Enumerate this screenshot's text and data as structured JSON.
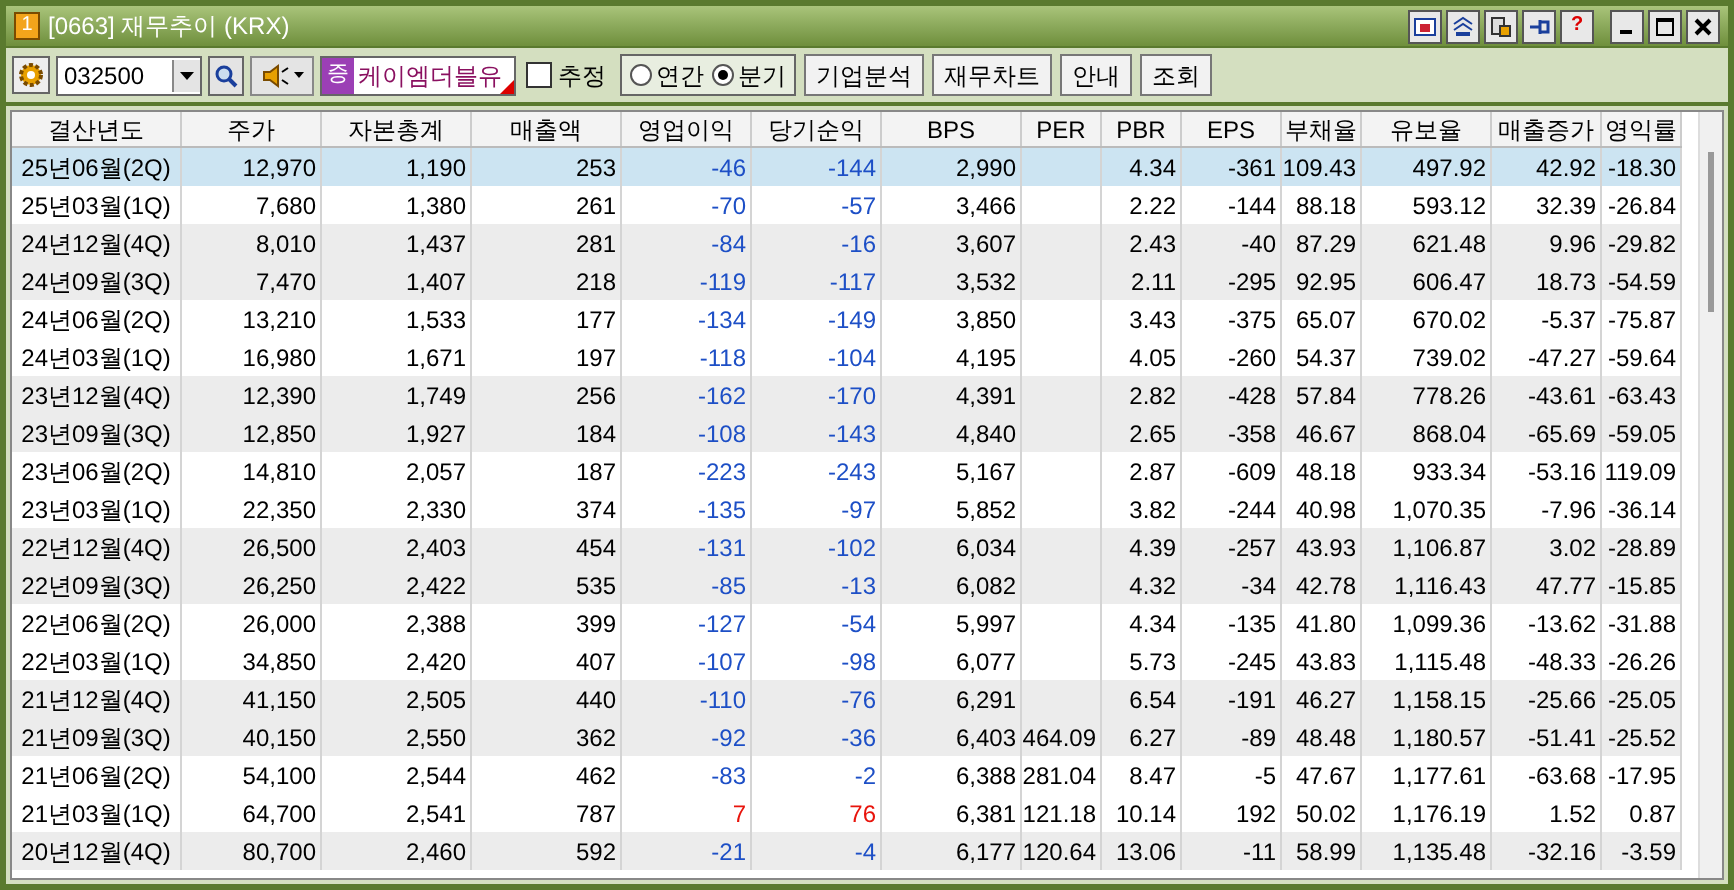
{
  "window": {
    "badge": "1",
    "title": "[0663] 재무추이 (KRX)",
    "help_glyph": "?"
  },
  "toolbar": {
    "code": "032500",
    "market_badge": "증",
    "company": "케이엠더블유",
    "estimate": {
      "label": "추정",
      "checked": false
    },
    "period": [
      {
        "label": "연간",
        "selected": false
      },
      {
        "label": "분기",
        "selected": true
      }
    ],
    "buttons": [
      "기업분석",
      "재무차트",
      "안내",
      "조회"
    ]
  },
  "table": {
    "columns": [
      "결산년도",
      "주가",
      "자본총계",
      "매출액",
      "영업이익",
      "당기순익",
      "BPS",
      "PER",
      "PBR",
      "EPS",
      "부채율",
      "유보율",
      "매출증가",
      "영익률"
    ],
    "rows": [
      {
        "selected": true,
        "loss": true,
        "cells": [
          "25년06월(2Q)",
          "12,970",
          "1,190",
          "253",
          "-46",
          "-144",
          "2,990",
          "",
          "4.34",
          "-361",
          "109.43",
          "497.92",
          "42.92",
          "-18.30"
        ]
      },
      {
        "selected": false,
        "shaded": false,
        "loss": true,
        "cells": [
          "25년03월(1Q)",
          "7,680",
          "1,380",
          "261",
          "-70",
          "-57",
          "3,466",
          "",
          "2.22",
          "-144",
          "88.18",
          "593.12",
          "32.39",
          "-26.84"
        ]
      },
      {
        "selected": false,
        "shaded": true,
        "loss": true,
        "cells": [
          "24년12월(4Q)",
          "8,010",
          "1,437",
          "281",
          "-84",
          "-16",
          "3,607",
          "",
          "2.43",
          "-40",
          "87.29",
          "621.48",
          "9.96",
          "-29.82"
        ]
      },
      {
        "selected": false,
        "shaded": true,
        "loss": true,
        "cells": [
          "24년09월(3Q)",
          "7,470",
          "1,407",
          "218",
          "-119",
          "-117",
          "3,532",
          "",
          "2.11",
          "-295",
          "92.95",
          "606.47",
          "18.73",
          "-54.59"
        ]
      },
      {
        "selected": false,
        "shaded": false,
        "loss": true,
        "cells": [
          "24년06월(2Q)",
          "13,210",
          "1,533",
          "177",
          "-134",
          "-149",
          "3,850",
          "",
          "3.43",
          "-375",
          "65.07",
          "670.02",
          "-5.37",
          "-75.87"
        ]
      },
      {
        "selected": false,
        "shaded": false,
        "loss": true,
        "cells": [
          "24년03월(1Q)",
          "16,980",
          "1,671",
          "197",
          "-118",
          "-104",
          "4,195",
          "",
          "4.05",
          "-260",
          "54.37",
          "739.02",
          "-47.27",
          "-59.64"
        ]
      },
      {
        "selected": false,
        "shaded": true,
        "loss": true,
        "cells": [
          "23년12월(4Q)",
          "12,390",
          "1,749",
          "256",
          "-162",
          "-170",
          "4,391",
          "",
          "2.82",
          "-428",
          "57.84",
          "778.26",
          "-43.61",
          "-63.43"
        ]
      },
      {
        "selected": false,
        "shaded": true,
        "loss": true,
        "cells": [
          "23년09월(3Q)",
          "12,850",
          "1,927",
          "184",
          "-108",
          "-143",
          "4,840",
          "",
          "2.65",
          "-358",
          "46.67",
          "868.04",
          "-65.69",
          "-59.05"
        ]
      },
      {
        "selected": false,
        "shaded": false,
        "loss": true,
        "cells": [
          "23년06월(2Q)",
          "14,810",
          "2,057",
          "187",
          "-223",
          "-243",
          "5,167",
          "",
          "2.87",
          "-609",
          "48.18",
          "933.34",
          "-53.16",
          "119.09"
        ]
      },
      {
        "selected": false,
        "shaded": false,
        "loss": true,
        "cells": [
          "23년03월(1Q)",
          "22,350",
          "2,330",
          "374",
          "-135",
          "-97",
          "5,852",
          "",
          "3.82",
          "-244",
          "40.98",
          "1,070.35",
          "-7.96",
          "-36.14"
        ]
      },
      {
        "selected": false,
        "shaded": true,
        "loss": true,
        "cells": [
          "22년12월(4Q)",
          "26,500",
          "2,403",
          "454",
          "-131",
          "-102",
          "6,034",
          "",
          "4.39",
          "-257",
          "43.93",
          "1,106.87",
          "3.02",
          "-28.89"
        ]
      },
      {
        "selected": false,
        "shaded": true,
        "loss": true,
        "cells": [
          "22년09월(3Q)",
          "26,250",
          "2,422",
          "535",
          "-85",
          "-13",
          "6,082",
          "",
          "4.32",
          "-34",
          "42.78",
          "1,116.43",
          "47.77",
          "-15.85"
        ]
      },
      {
        "selected": false,
        "shaded": false,
        "loss": true,
        "cells": [
          "22년06월(2Q)",
          "26,000",
          "2,388",
          "399",
          "-127",
          "-54",
          "5,997",
          "",
          "4.34",
          "-135",
          "41.80",
          "1,099.36",
          "-13.62",
          "-31.88"
        ]
      },
      {
        "selected": false,
        "shaded": false,
        "loss": true,
        "cells": [
          "22년03월(1Q)",
          "34,850",
          "2,420",
          "407",
          "-107",
          "-98",
          "6,077",
          "",
          "5.73",
          "-245",
          "43.83",
          "1,115.48",
          "-48.33",
          "-26.26"
        ]
      },
      {
        "selected": false,
        "shaded": true,
        "loss": true,
        "cells": [
          "21년12월(4Q)",
          "41,150",
          "2,505",
          "440",
          "-110",
          "-76",
          "6,291",
          "",
          "6.54",
          "-191",
          "46.27",
          "1,158.15",
          "-25.66",
          "-25.05"
        ]
      },
      {
        "selected": false,
        "shaded": true,
        "loss": true,
        "cells": [
          "21년09월(3Q)",
          "40,150",
          "2,550",
          "362",
          "-92",
          "-36",
          "6,403",
          "464.09",
          "6.27",
          "-89",
          "48.48",
          "1,180.57",
          "-51.41",
          "-25.52"
        ]
      },
      {
        "selected": false,
        "shaded": false,
        "loss": true,
        "cells": [
          "21년06월(2Q)",
          "54,100",
          "2,544",
          "462",
          "-83",
          "-2",
          "6,388",
          "281.04",
          "8.47",
          "-5",
          "47.67",
          "1,177.61",
          "-63.68",
          "-17.95"
        ]
      },
      {
        "selected": false,
        "shaded": false,
        "loss": false,
        "cells": [
          "21년03월(1Q)",
          "64,700",
          "2,541",
          "787",
          "7",
          "76",
          "6,381",
          "121.18",
          "10.14",
          "192",
          "50.02",
          "1,176.19",
          "1.52",
          "0.87"
        ]
      },
      {
        "selected": false,
        "shaded": true,
        "loss": true,
        "cells": [
          "20년12월(4Q)",
          "80,700",
          "2,460",
          "592",
          "-21",
          "-4",
          "6,177",
          "120.64",
          "13.06",
          "-11",
          "58.99",
          "1,135.48",
          "-32.16",
          "-3.59"
        ]
      }
    ]
  }
}
